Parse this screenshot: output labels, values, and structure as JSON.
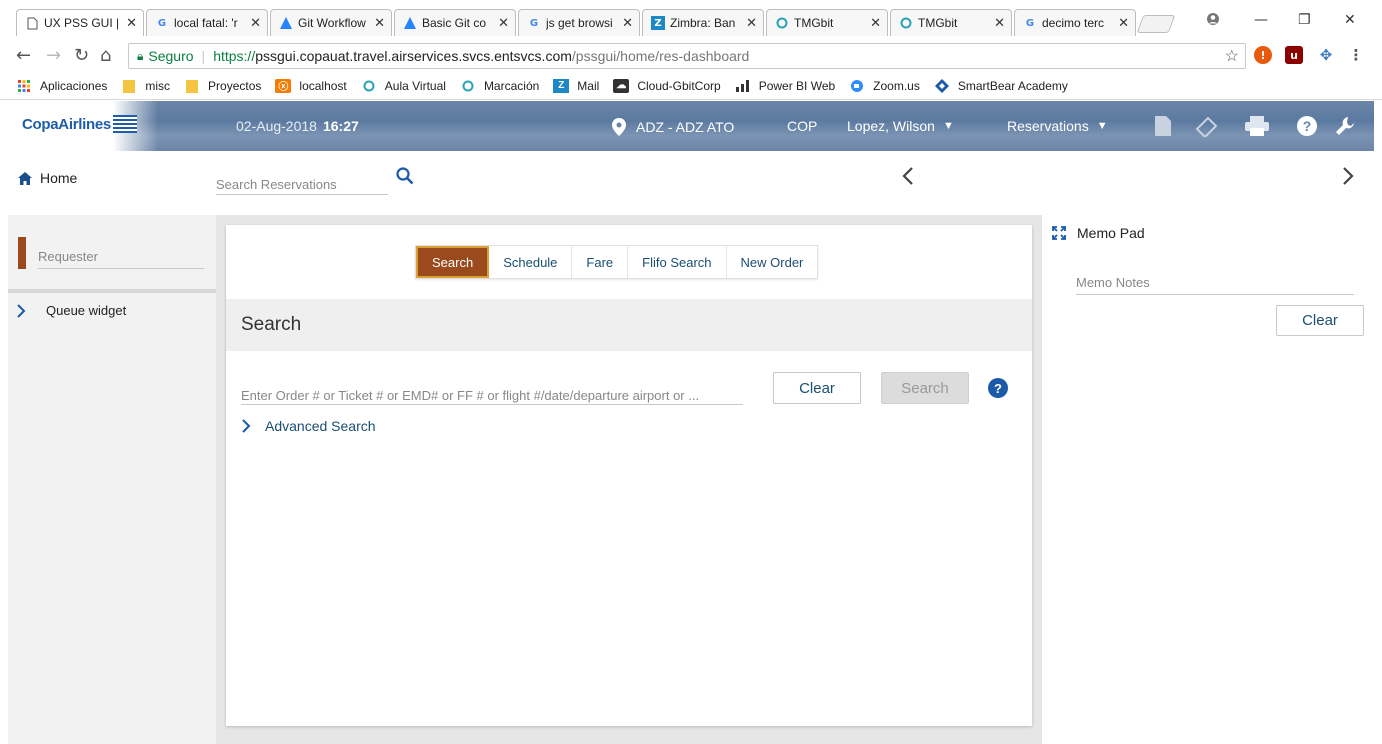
{
  "browser": {
    "tabs": [
      {
        "title": "UX PSS GUI |",
        "icon": "page-icon",
        "active": true
      },
      {
        "title": "local fatal: 'r",
        "icon": "google-icon"
      },
      {
        "title": "Git Workflow",
        "icon": "atlassian-icon"
      },
      {
        "title": "Basic Git co",
        "icon": "atlassian-icon"
      },
      {
        "title": "js get browsi",
        "icon": "google-icon"
      },
      {
        "title": "Zimbra: Ban",
        "icon": "zimbra-icon"
      },
      {
        "title": "TMGbit",
        "icon": "circle-icon"
      },
      {
        "title": "TMGbit",
        "icon": "circle-icon"
      },
      {
        "title": "decimo terc",
        "icon": "google-icon"
      }
    ],
    "address": {
      "secure_label": "Seguro",
      "scheme": "https://",
      "host": "pssgui.copauat.travel.airservices.svcs.entsvcs.com",
      "path": "/pssgui/home/res-dashboard"
    },
    "bookmarks": [
      {
        "label": "Aplicaciones",
        "icon": "apps-grid-icon"
      },
      {
        "label": "misc",
        "icon": "folder-icon"
      },
      {
        "label": "Proyectos",
        "icon": "folder-icon"
      },
      {
        "label": "localhost",
        "icon": "xampp-icon"
      },
      {
        "label": "Aula Virtual",
        "icon": "circle-icon"
      },
      {
        "label": "Marcación",
        "icon": "circle-icon"
      },
      {
        "label": "Mail",
        "icon": "zimbra-icon"
      },
      {
        "label": "Cloud-GbitCorp",
        "icon": "cloud-icon"
      },
      {
        "label": "Power BI Web",
        "icon": "powerbi-icon"
      },
      {
        "label": "Zoom.us",
        "icon": "zoom-icon"
      },
      {
        "label": "SmartBear Academy",
        "icon": "smartbear-icon"
      }
    ]
  },
  "header": {
    "logo_text": "CopaAirlines",
    "date": "02-Aug-2018",
    "time": "16:27",
    "location": "ADZ - ADZ ATO",
    "currency": "COP",
    "user": "Lopez, Wilson",
    "menu": "Reservations"
  },
  "searchrow": {
    "home_label": "Home",
    "search_placeholder": "Search Reservations"
  },
  "left": {
    "requester_placeholder": "Requester",
    "queue_label": "Queue widget"
  },
  "main": {
    "tabs": [
      "Search",
      "Schedule",
      "Fare",
      "Flifo Search",
      "New Order"
    ],
    "active_tab": "Search",
    "section_title": "Search",
    "order_placeholder": "Enter Order # or Ticket # or EMD# or FF # or flight #/date/departure airport or ...",
    "clear_label": "Clear",
    "search_label": "Search",
    "help_label": "?",
    "advanced_label": "Advanced Search"
  },
  "memo": {
    "title": "Memo Pad",
    "placeholder": "Memo Notes",
    "clear_label": "Clear"
  },
  "colors": {
    "accent": "#9b4a1e",
    "link": "#1b4f72",
    "brand": "#1f5da8"
  }
}
